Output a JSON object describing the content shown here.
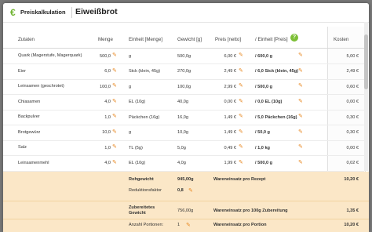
{
  "app": {
    "name": "Preiskalkulation",
    "logo_glyph": "€",
    "accent": "#6fb330"
  },
  "recipe": {
    "title": "Eiweißbrot"
  },
  "columns": [
    "Zutaten",
    "Menge",
    "Einheit [Menge]",
    "Gewicht [g]",
    "Preis [netto]",
    "/ Einheit [Preis]",
    "Kosten"
  ],
  "help_glyph": "?",
  "rows": [
    {
      "name": "Quark (Magerstufe, Magerquark)",
      "amount": "500,0",
      "unit": "g",
      "weight": "500,0g",
      "price": "6,00 €",
      "per_unit": "/ 600,0 g",
      "cost": "5,00 €"
    },
    {
      "name": "Eier",
      "amount": "6,0",
      "unit": "Stck (klein, 45g)",
      "weight": "270,0g",
      "price": "2,49 €",
      "per_unit": "/ 6,0 Stck (klein, 45g)",
      "cost": "2,49 €"
    },
    {
      "name": "Leinsamen (geschrotet)",
      "amount": "100,0",
      "unit": "g",
      "weight": "100,0g",
      "price": "2,99 €",
      "per_unit": "/ 500,0 g",
      "cost": "0,60 €"
    },
    {
      "name": "Chiasamen",
      "amount": "4,0",
      "unit": "EL (10g)",
      "weight": "40,0g",
      "price": "0,00 €",
      "per_unit": "/ 0,0 EL (10g)",
      "cost": "0,00 €"
    },
    {
      "name": "Backpulver",
      "amount": "1,0",
      "unit": "Päckchen (16g)",
      "weight": "16,0g",
      "price": "1,49 €",
      "per_unit": "/ 5,0 Päckchen (16g)",
      "cost": "0,30 €"
    },
    {
      "name": "Brotgewürz",
      "amount": "10,0",
      "unit": "g",
      "weight": "10,0g",
      "price": "1,49 €",
      "per_unit": "/ 50,0 g",
      "cost": "0,30 €"
    },
    {
      "name": "Salz",
      "amount": "1,0",
      "unit": "TL (5g)",
      "weight": "5,0g",
      "price": "0,49 €",
      "per_unit": "/ 1,0 kg",
      "cost": "0,00 €"
    },
    {
      "name": "Leinsamenmehl",
      "amount": "4,0",
      "unit": "EL (10g)",
      "weight": "4,0g",
      "price": "1,99 €",
      "per_unit": "/ 500,0 g",
      "cost": "0,02 €"
    }
  ],
  "summary": {
    "rohgewicht_label": "Rohgewicht",
    "rohgewicht_value": "945,00g",
    "wareneinsatz_rezept_label": "Wareneinsatz pro Rezept",
    "wareneinsatz_rezept_value": "10,20 €",
    "reduktionsfaktor_label": "Reduktionsfaktor",
    "reduktionsfaktor_value": "0,8",
    "zubereitet_label": "Zubereitetes Gewicht",
    "zubereitet_value": "756,00g",
    "wareneinsatz_100g_label": "Wareneinsatz pro 100g Zubereitung",
    "wareneinsatz_100g_value": "1,35 €",
    "portionen_label": "Anzahl Portionen:",
    "portionen_value": "1",
    "wareneinsatz_portion_label": "Wareneinsatz pro Portion",
    "wareneinsatz_portion_value": "10,20 €"
  }
}
